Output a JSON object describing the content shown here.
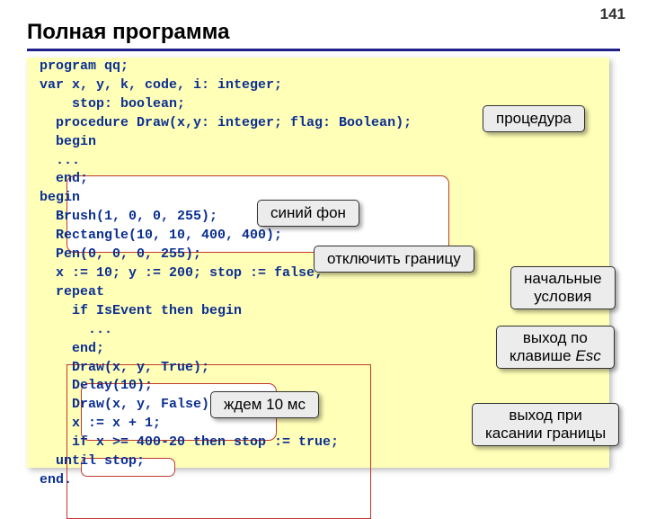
{
  "page_number": "141",
  "title": "Полная программа",
  "code": {
    "l1": "program qq;",
    "l2": "var x, y, k, code, i: integer;",
    "l3": "    stop: boolean;",
    "l4": "  procedure Draw(x,y: integer; flag: Boolean);",
    "l5": "  begin",
    "l6": "  ...",
    "l7": "  end;",
    "l8": "begin",
    "l9": "  Brush(1, 0, 0, 255);",
    "l10": "  Rectangle(10, 10, 400, 400);",
    "l11": "  Pen(0, 0, 0, 255);",
    "l12": "  x := 10; y := 200; stop := false;",
    "l13": "  repeat",
    "l14": "    if IsEvent then begin",
    "l15": "      ...",
    "l16": "    end;",
    "l17": "    Draw(x, y, True);",
    "l18": "    Delay(10);",
    "l19": "    Draw(x, y, False);",
    "l20": "    x := x + 1;",
    "l21": "    if x >= 400-20 then stop := true;",
    "l22": "  until stop;",
    "l23": "end."
  },
  "callouts": {
    "procedure": "процедура",
    "blue_bg": "синий фон",
    "disable_border": "отключить границу",
    "initial_cond_l1": "начальные",
    "initial_cond_l2": "условия",
    "exit_esc_l1": "выход по",
    "exit_esc_prefix": "клавише ",
    "exit_esc_key": "Esc",
    "wait_10ms": "ждем 10 мс",
    "exit_touch_l1": "выход при",
    "exit_touch_l2": "касании границы"
  }
}
